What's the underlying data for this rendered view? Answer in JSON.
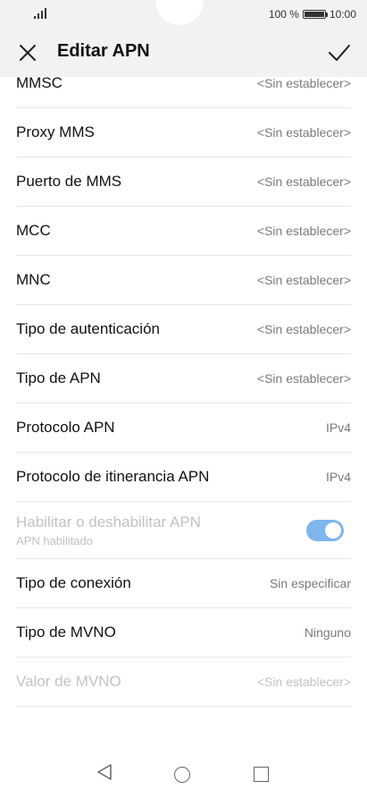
{
  "status_bar": {
    "battery_text": "100 %",
    "time": "10:00"
  },
  "header": {
    "title": "Editar APN"
  },
  "rows": [
    {
      "label": "MMSC",
      "value": "<Sin establecer>"
    },
    {
      "label": "Proxy MMS",
      "value": "<Sin establecer>"
    },
    {
      "label": "Puerto de MMS",
      "value": "<Sin establecer>"
    },
    {
      "label": "MCC",
      "value": "<Sin establecer>"
    },
    {
      "label": "MNC",
      "value": "<Sin establecer>"
    },
    {
      "label": "Tipo de autenticación",
      "value": "<Sin establecer>"
    },
    {
      "label": "Tipo de APN",
      "value": "<Sin establecer>"
    },
    {
      "label": "Protocolo APN",
      "value": "IPv4"
    },
    {
      "label": "Protocolo de itinerancia APN",
      "value": "IPv4"
    },
    {
      "label": "Habilitar o deshabilitar APN",
      "sublabel": "APN habilitado",
      "toggle_on": true
    },
    {
      "label": "Tipo de conexión",
      "value": "Sin especificar"
    },
    {
      "label": "Tipo de MVNO",
      "value": "Ninguno"
    },
    {
      "label": "Valor de MVNO",
      "value": "<Sin establecer>"
    }
  ],
  "colors": {
    "toggle_on": "#7fb5ec",
    "disabled_text": "#c2c2c2"
  }
}
